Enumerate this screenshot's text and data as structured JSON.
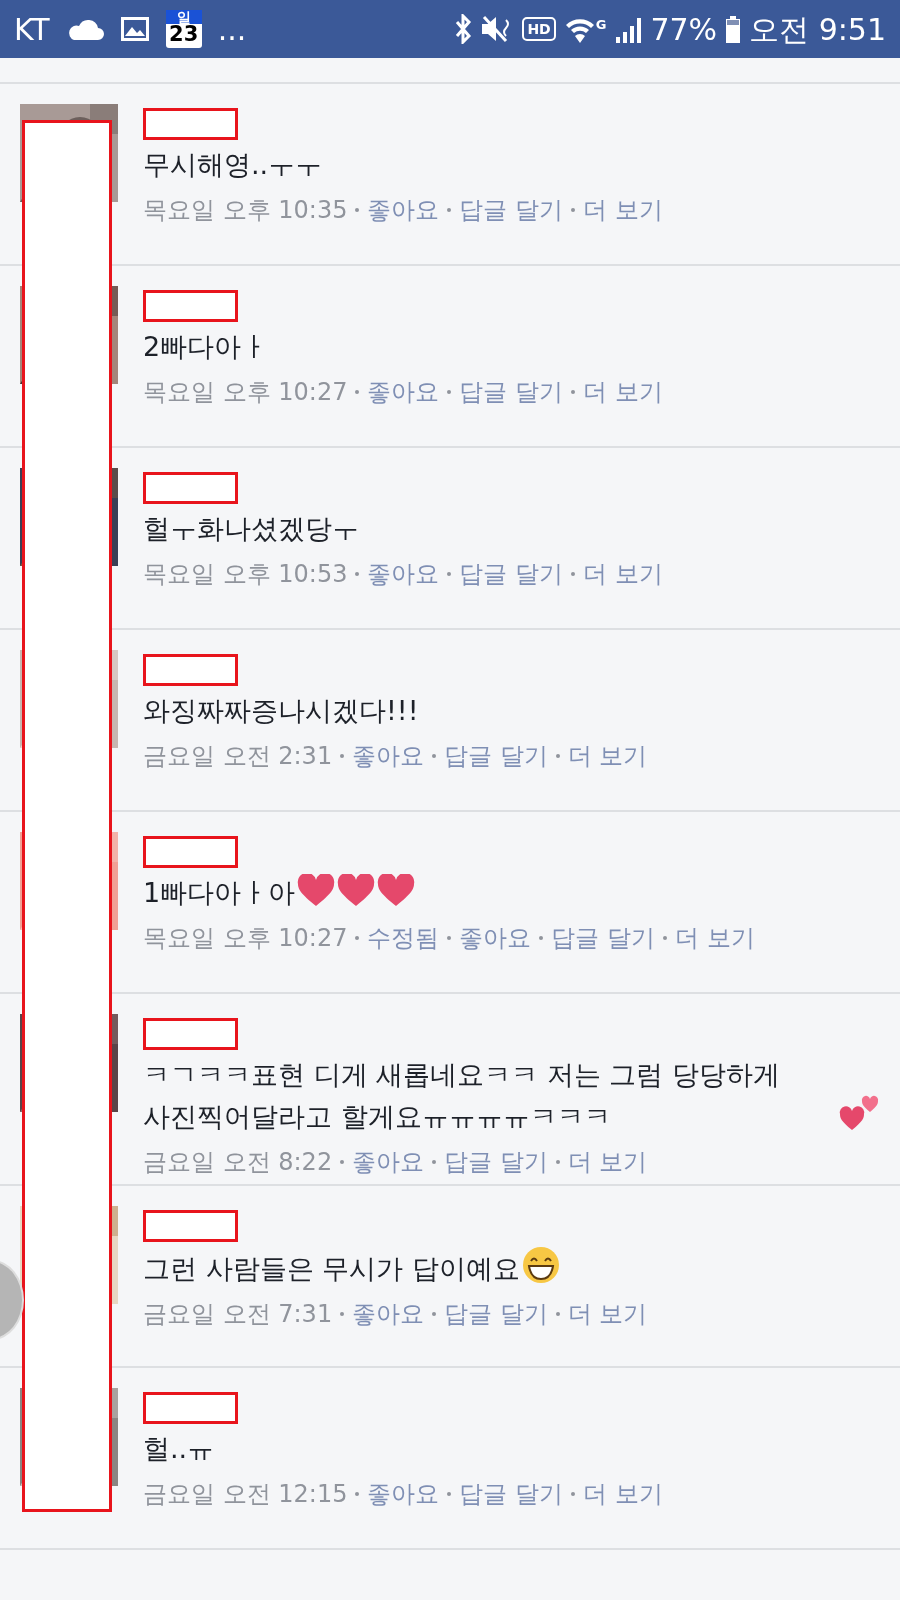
{
  "status_bar": {
    "carrier": "KT",
    "calendar_weekday": "일",
    "calendar_day": "23",
    "more": "...",
    "hd": "HD",
    "network": "G",
    "battery": "77%",
    "time": "오전 9:51"
  },
  "comments": [
    {
      "name_redacted": true,
      "text": "무시해영..ㅜㅜ",
      "meta": [
        {
          "kind": "time",
          "text": "목요일 오후 10:35"
        },
        {
          "kind": "link",
          "text": "좋아요"
        },
        {
          "kind": "link",
          "text": "답글 달기"
        },
        {
          "kind": "link",
          "text": "더 보기"
        }
      ]
    },
    {
      "name_redacted": true,
      "text": "2빠다아ㅏ",
      "meta": [
        {
          "kind": "time",
          "text": "목요일 오후 10:27"
        },
        {
          "kind": "link",
          "text": "좋아요"
        },
        {
          "kind": "link",
          "text": "답글 달기"
        },
        {
          "kind": "link",
          "text": "더 보기"
        }
      ]
    },
    {
      "name_redacted": true,
      "text": "헐ㅜ화나셨겠당ㅜ",
      "meta": [
        {
          "kind": "time",
          "text": "목요일 오후 10:53"
        },
        {
          "kind": "link",
          "text": "좋아요"
        },
        {
          "kind": "link",
          "text": "답글 달기"
        },
        {
          "kind": "link",
          "text": "더 보기"
        }
      ]
    },
    {
      "name_redacted": true,
      "text": "와징짜짜증나시겠다!!!",
      "meta": [
        {
          "kind": "time",
          "text": "금요일 오전 2:31"
        },
        {
          "kind": "link",
          "text": "좋아요"
        },
        {
          "kind": "link",
          "text": "답글 달기"
        },
        {
          "kind": "link",
          "text": "더 보기"
        }
      ]
    },
    {
      "name_redacted": true,
      "text": "1빠다아ㅏ아",
      "emoji": [
        {
          "kind": "heart"
        },
        {
          "kind": "heart"
        },
        {
          "kind": "heart"
        }
      ],
      "meta": [
        {
          "kind": "time",
          "text": "목요일 오후 10:27"
        },
        {
          "kind": "link",
          "text": "수정됨"
        },
        {
          "kind": "link",
          "text": "좋아요"
        },
        {
          "kind": "link",
          "text": "답글 달기"
        },
        {
          "kind": "link",
          "text": "더 보기"
        }
      ]
    },
    {
      "name_redacted": true,
      "text": "ㅋㄱㅋㅋ표현 디게 새롭네요ㅋㅋ 저는 그럼 당당하게 사진찍어달라고 할게요ㅠㅠㅠㅠㅋㅋㅋ",
      "emoji": [
        {
          "kind": "two_hearts"
        }
      ],
      "meta": [
        {
          "kind": "time",
          "text": "금요일 오전 8:22"
        },
        {
          "kind": "link",
          "text": "좋아요"
        },
        {
          "kind": "link",
          "text": "답글 달기"
        },
        {
          "kind": "link",
          "text": "더 보기"
        }
      ]
    },
    {
      "name_redacted": true,
      "text": "그런 사람들은 무시가 답이예요",
      "emoji": [
        {
          "kind": "grin"
        }
      ],
      "meta": [
        {
          "kind": "time",
          "text": "금요일 오전 7:31"
        },
        {
          "kind": "link",
          "text": "좋아요"
        },
        {
          "kind": "link",
          "text": "답글 달기"
        },
        {
          "kind": "link",
          "text": "더 보기"
        }
      ]
    },
    {
      "name_redacted": true,
      "text": "헐..ㅠ",
      "meta": [
        {
          "kind": "time",
          "text": "금요일 오전 12:15"
        },
        {
          "kind": "link",
          "text": "좋아요"
        },
        {
          "kind": "link",
          "text": "답글 달기"
        },
        {
          "kind": "link",
          "text": "더 보기"
        }
      ]
    }
  ]
}
